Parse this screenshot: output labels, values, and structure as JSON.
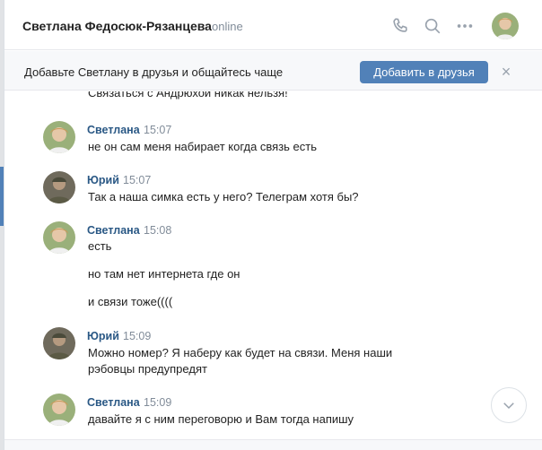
{
  "header": {
    "title": "Светлана Федосюк-Рязанцева",
    "status": "online"
  },
  "icons": {
    "call": "phone-icon",
    "search": "search-icon",
    "more": "more-icon",
    "scroll": "chevron-down-icon"
  },
  "banner": {
    "text": "Добавьте Светлану в друзья и общайтесь чаще",
    "button": "Добавить в друзья",
    "close": "×"
  },
  "history": {
    "cut_text": "Связаться с Андрюхой никак нельзя!"
  },
  "messages": [
    {
      "author": "Светлана",
      "time": "15:07",
      "lines": [
        "не он сам меня набирает когда связь есть"
      ]
    },
    {
      "author": "Юрий",
      "time": "15:07",
      "lines": [
        "Так а наша симка есть у него? Телеграм хотя бы?"
      ]
    },
    {
      "author": "Светлана",
      "time": "15:08",
      "lines": [
        "есть",
        "но там нет интернета где он",
        "и связи тоже(((("
      ]
    },
    {
      "author": "Юрий",
      "time": "15:09",
      "lines": [
        "Можно номер? Я наберу как будет на связи. Меня наши",
        "рэбовцы предупредят"
      ]
    },
    {
      "author": "Светлана",
      "time": "15:09",
      "lines": [
        "давайте я с ним переговорю и Вам тогда напишу"
      ]
    }
  ],
  "colors": {
    "accent": "#5181b8",
    "author": "#2a5885",
    "muted": "#818c99"
  }
}
